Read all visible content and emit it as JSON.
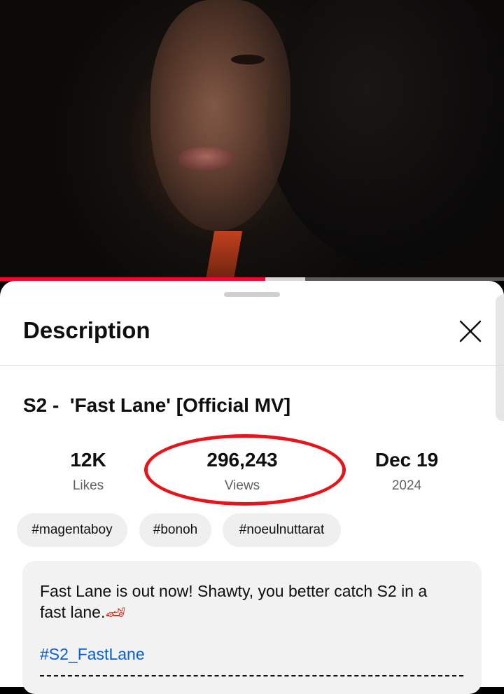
{
  "progress": {
    "played_fraction": 0.527,
    "buffered_fraction": 0.605
  },
  "sheet": {
    "title": "Description"
  },
  "video": {
    "title": "S2 -  'Fast Lane' [Official MV]",
    "stats": [
      {
        "value": "12K",
        "label": "Likes"
      },
      {
        "value": "296,243",
        "label": "Views"
      },
      {
        "value": "Dec 19",
        "label": "2024"
      }
    ],
    "hashtags": [
      "#magentaboy",
      "#bonoh",
      "#noeulnuttarat"
    ],
    "description": {
      "line1": "Fast Lane is out now! Shawty, you better catch S2 in a",
      "line2": "fast lane.",
      "emoji": "🏎",
      "hashtag": "#S2_FastLane"
    }
  },
  "icons": {
    "close": "close-icon",
    "annotation": "red-circle-annotation"
  },
  "colors": {
    "accent_red": "#ff0033",
    "link_blue": "#065fd4",
    "annotation_red": "#e8141c"
  }
}
